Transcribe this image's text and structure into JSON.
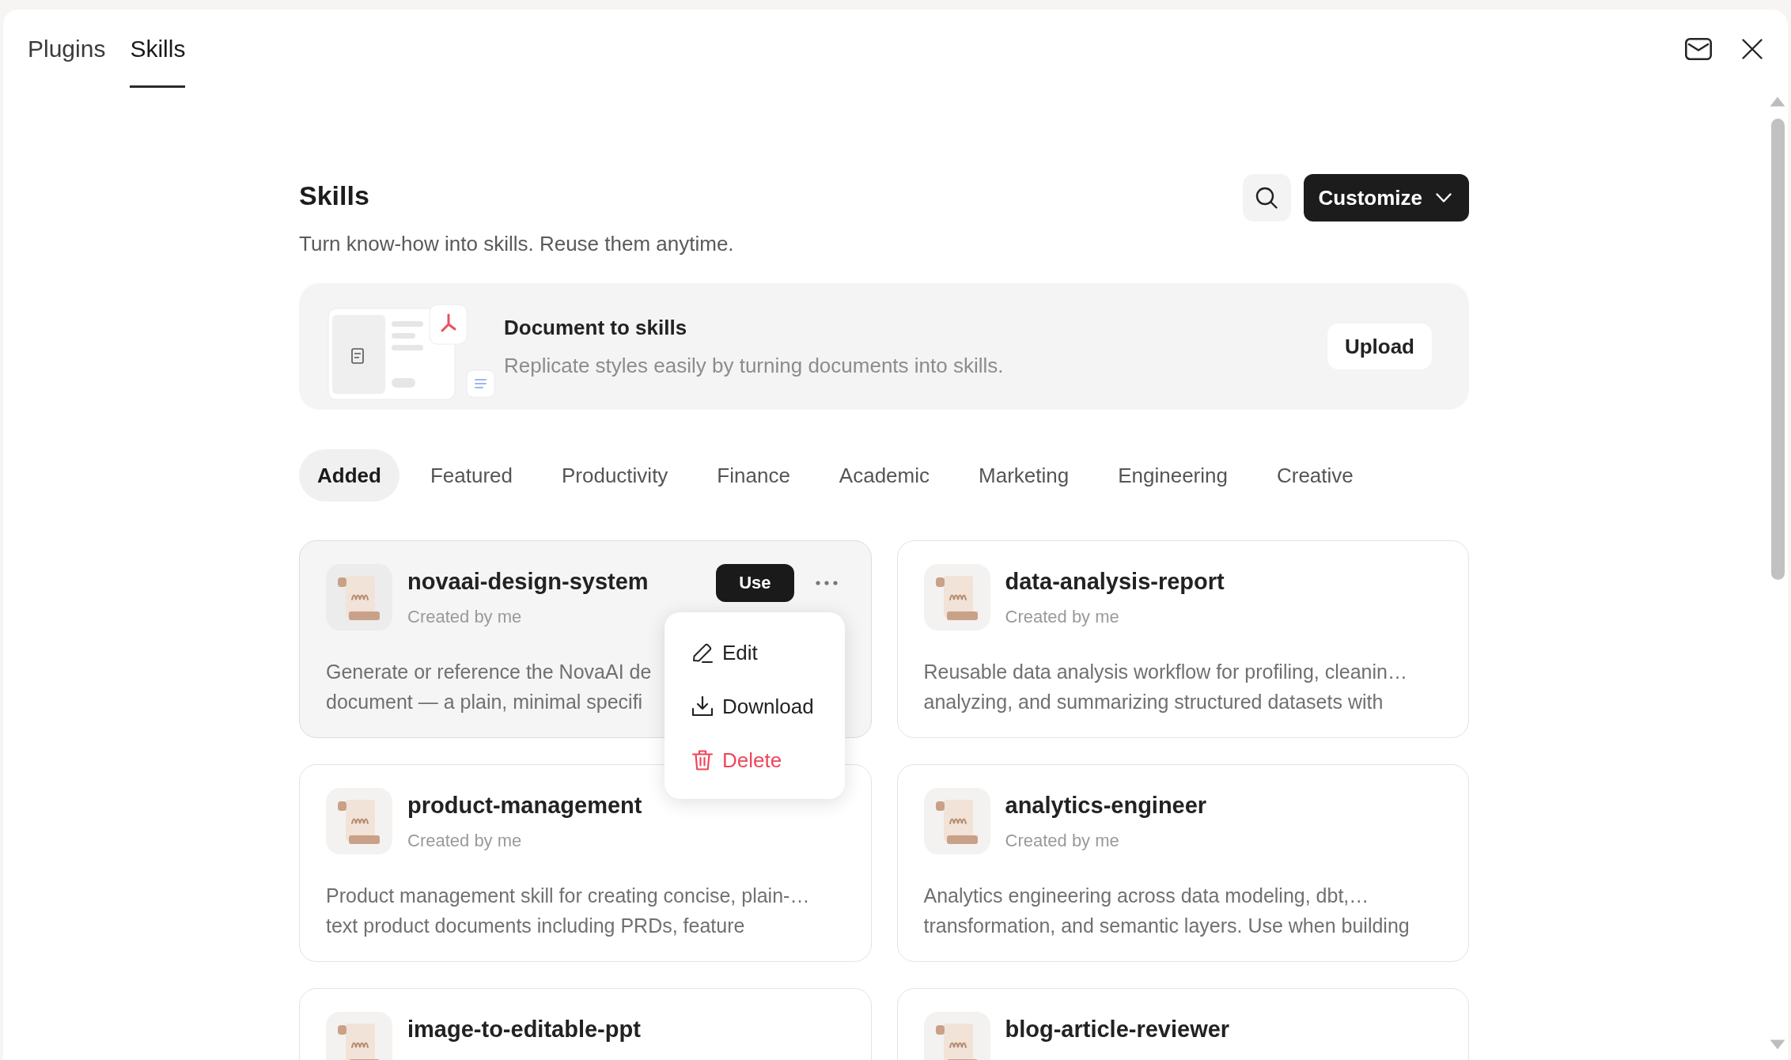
{
  "window": {
    "tabs": [
      {
        "label": "Plugins",
        "selected": false
      },
      {
        "label": "Skills",
        "selected": true
      }
    ]
  },
  "header": {
    "title": "Skills",
    "subtitle": "Turn know-how into skills. Reuse them anytime.",
    "customize_button": "Customize"
  },
  "banner": {
    "title": "Document to skills",
    "description": "Replicate styles easily by turning documents into skills.",
    "button": "Upload"
  },
  "categories": [
    {
      "label": "Added",
      "selected": true
    },
    {
      "label": "Featured",
      "selected": false
    },
    {
      "label": "Productivity",
      "selected": false
    },
    {
      "label": "Finance",
      "selected": false
    },
    {
      "label": "Academic",
      "selected": false
    },
    {
      "label": "Marketing",
      "selected": false
    },
    {
      "label": "Engineering",
      "selected": false
    },
    {
      "label": "Creative",
      "selected": false
    }
  ],
  "skills": [
    {
      "name": "novaai-design-system",
      "author": "Created by me",
      "description_lines": [
        "Generate or reference the NovaAI de",
        "document — a plain, minimal specifi"
      ],
      "hovered": true,
      "use_button": "Use",
      "menu": [
        {
          "kind": "edit",
          "label": "Edit"
        },
        {
          "kind": "download",
          "label": "Download"
        },
        {
          "kind": "delete",
          "label": "Delete"
        }
      ]
    },
    {
      "name": "data-analysis-report",
      "author": "Created by me",
      "description_lines": [
        "Reusable data analysis workflow for profiling, cleanin…",
        "analyzing, and summarizing structured datasets with"
      ],
      "hovered": false
    },
    {
      "name": "product-management",
      "author": "Created by me",
      "description_lines": [
        "Product management skill for creating concise, plain-…",
        "text product documents including PRDs, feature"
      ],
      "hovered": false
    },
    {
      "name": "analytics-engineer",
      "author": "Created by me",
      "description_lines": [
        "Analytics engineering across data modeling, dbt,…",
        "transformation, and semantic layers. Use when building"
      ],
      "hovered": false
    },
    {
      "name": "image-to-editable-ppt",
      "hovered": false
    },
    {
      "name": "blog-article-reviewer",
      "hovered": false
    }
  ]
}
